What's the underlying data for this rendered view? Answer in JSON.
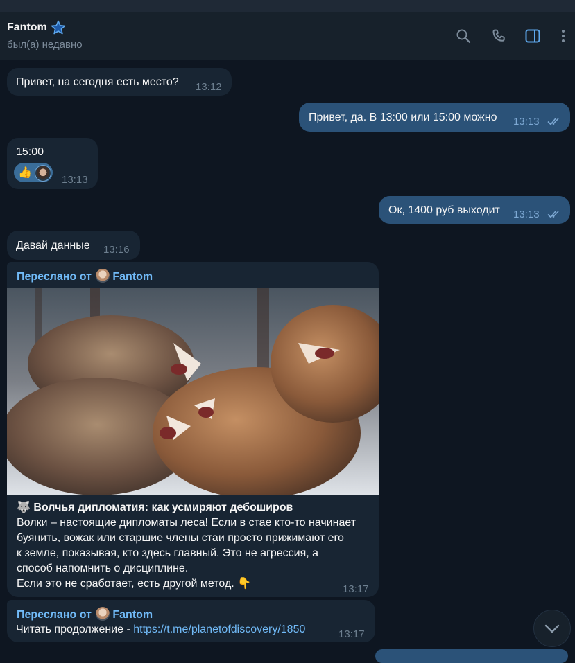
{
  "header": {
    "name": "Fantom",
    "status": "был(а) недавно",
    "icons": [
      "search-icon",
      "phone-icon",
      "sidebar-toggle-icon",
      "more-vertical-icon"
    ]
  },
  "messages": [
    {
      "dir": "in",
      "text": "Привет, на сегодня есть место?",
      "time": "13:12"
    },
    {
      "dir": "out",
      "text": "Привет, да. В 13:00 или 15:00 можно",
      "time": "13:13",
      "read": true
    },
    {
      "dir": "in",
      "text": "15:00",
      "time": "13:13",
      "reaction": "👍"
    },
    {
      "dir": "out",
      "text": "Ок, 1400 руб выходит",
      "time": "13:13",
      "read": true
    },
    {
      "dir": "in",
      "text": "Давай данные",
      "time": "13:16"
    }
  ],
  "forward_post": {
    "forwarded_prefix": "Переслано от",
    "forwarded_from": "Fantom",
    "title_emoji": "🐺",
    "title": "Волчья дипломатия: как усмиряют дебоширов",
    "body_lines": [
      "Волки – настоящие дипломаты леса! Если в стае кто-то начинает",
      "буянить, вожак или старшие члены стаи просто прижимают его",
      "к земле, показывая, кто здесь главный. Это не агрессия, а",
      "способ напомнить о дисциплине."
    ],
    "last_line": "Если это не сработает, есть другой метод.",
    "last_emoji": "👇",
    "time": "13:17"
  },
  "forward_link": {
    "forwarded_prefix": "Переслано от",
    "forwarded_from": "Fantom",
    "text": "Читать продолжение - ",
    "link": "https://t.me/planetofdiscovery/1850",
    "time": "13:17"
  },
  "colors": {
    "background": "#0e1621",
    "header": "#17212b",
    "incoming_bubble": "#182533",
    "outgoing_bubble": "#2b5278",
    "link": "#71baf7",
    "accent_icon": "#5ea7eb"
  }
}
